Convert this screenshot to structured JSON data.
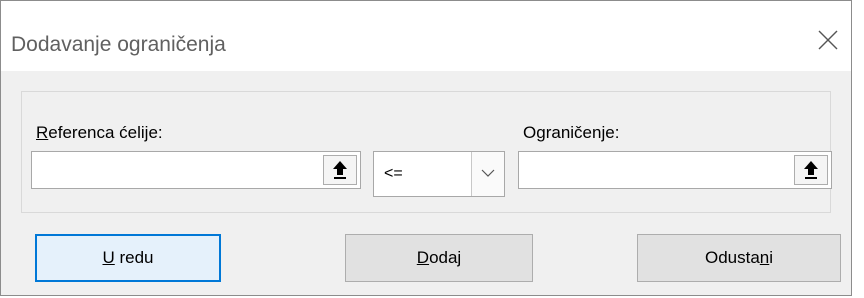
{
  "dialog": {
    "title": "Dodavanje ograničenja",
    "close_icon": "close-icon"
  },
  "cell_reference": {
    "label_mnemonic": "R",
    "label_rest": "eferenca ćelije:",
    "value": "",
    "button_icon": "collapse-dialog-arrow-icon"
  },
  "operator": {
    "selected": "<=",
    "dropdown_icon": "chevron-down-icon"
  },
  "constraint": {
    "label_pre": "O",
    "label_mnemonic": "g",
    "label_rest": "raničenje:",
    "value": "",
    "button_icon": "collapse-dialog-arrow-icon"
  },
  "buttons": {
    "ok_mnemonic": "U",
    "ok_rest": " redu",
    "add_mnemonic": "D",
    "add_rest": "odaj",
    "cancel_pre": "Odusta",
    "cancel_mnemonic": "n",
    "cancel_rest": "i"
  },
  "colors": {
    "accent": "#0078d7",
    "dialog_bg": "#f0f0f0"
  }
}
